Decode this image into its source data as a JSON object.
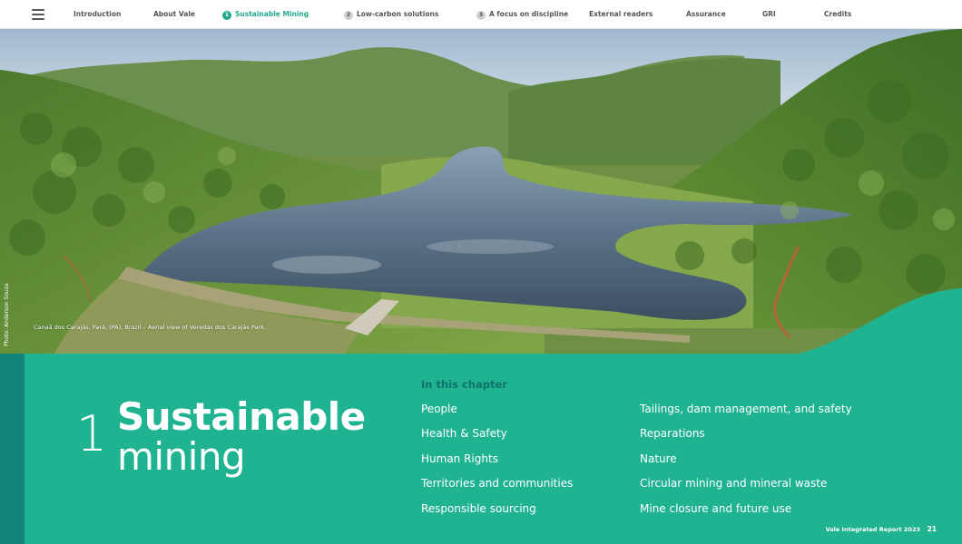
{
  "nav": {
    "items": [
      {
        "label": "Introduction",
        "number": "",
        "active": false
      },
      {
        "label": "About Vale",
        "number": "",
        "active": false
      },
      {
        "label": "Sustainable Mining",
        "number": "1",
        "active": true
      },
      {
        "label": "Low-carbon solutions",
        "number": "2",
        "active": false
      },
      {
        "label": "A focus on discipline",
        "number": "3",
        "active": false
      },
      {
        "label": "External readers",
        "number": "",
        "active": false
      },
      {
        "label": "Assurance",
        "number": "",
        "active": false
      },
      {
        "label": "GRI",
        "number": "",
        "active": false
      },
      {
        "label": "Credits",
        "number": "",
        "active": false
      }
    ]
  },
  "hero": {
    "photo_credit": "Photo: Anderson Souza",
    "caption": "Canaã dos Carajás, Pará, (PA), Brazil – Aerial view of Veredas dos Carajás Park."
  },
  "chapter": {
    "number": "1",
    "title_line1": "Sustainable",
    "title_line2": "mining",
    "in_this_chapter": "In this chapter",
    "links_left": [
      "People",
      "Health & Safety",
      "Human Rights",
      "Territories and communities",
      "Responsible sourcing"
    ],
    "links_right": [
      "Tailings, dam management, and safety",
      "Reparations",
      "Nature",
      "Circular mining and mineral waste",
      "Mine closure and future use"
    ]
  },
  "footer": {
    "report_name": "Vale Integrated Report 2023",
    "page_number": "21"
  },
  "colors": {
    "accent": "#22a98c",
    "panel": "#20b392",
    "strip": "#12847a",
    "heading_dark": "#10706a"
  }
}
